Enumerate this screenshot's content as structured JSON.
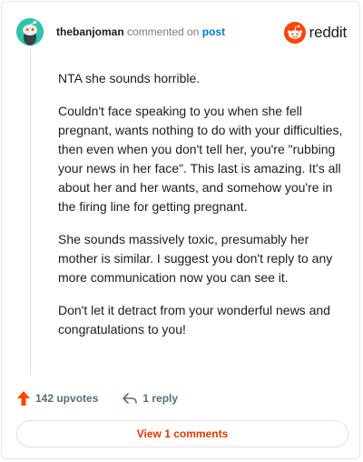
{
  "header": {
    "username": "thebanjoman",
    "action_text": "commented on",
    "post_link": "post",
    "brand_name": "reddit"
  },
  "comment": {
    "paragraphs": [
      "NTA she sounds horrible.",
      "Couldn't face speaking to you when she fell pregnant, wants nothing to do with your difficulties, then even when you don't tell her, you're \"rubbing your news in her face\". This last is amazing. It's all about her and her wants, and somehow you're in the firing line for getting pregnant.",
      "She sounds massively toxic, presumably her mother is similar. I suggest you don't reply to any more communication now you can see it.",
      "Don't let it detract from your wonderful news and congratulations to you!"
    ]
  },
  "actions": {
    "upvotes": "142 upvotes",
    "replies": "1 reply"
  },
  "footer": {
    "view_comments": "View 1 comments"
  },
  "colors": {
    "avatar": "#2fc3a8",
    "brand_orange": "#ff4500",
    "link_blue": "#0079d3",
    "upvote": "#ff4500",
    "view_button_text": "#d93a00"
  },
  "icons": {
    "avatar": "snoo-avatar-icon",
    "brand": "reddit-logo-icon",
    "upvote": "upvote-arrow-icon",
    "reply": "reply-arrow-icon"
  }
}
